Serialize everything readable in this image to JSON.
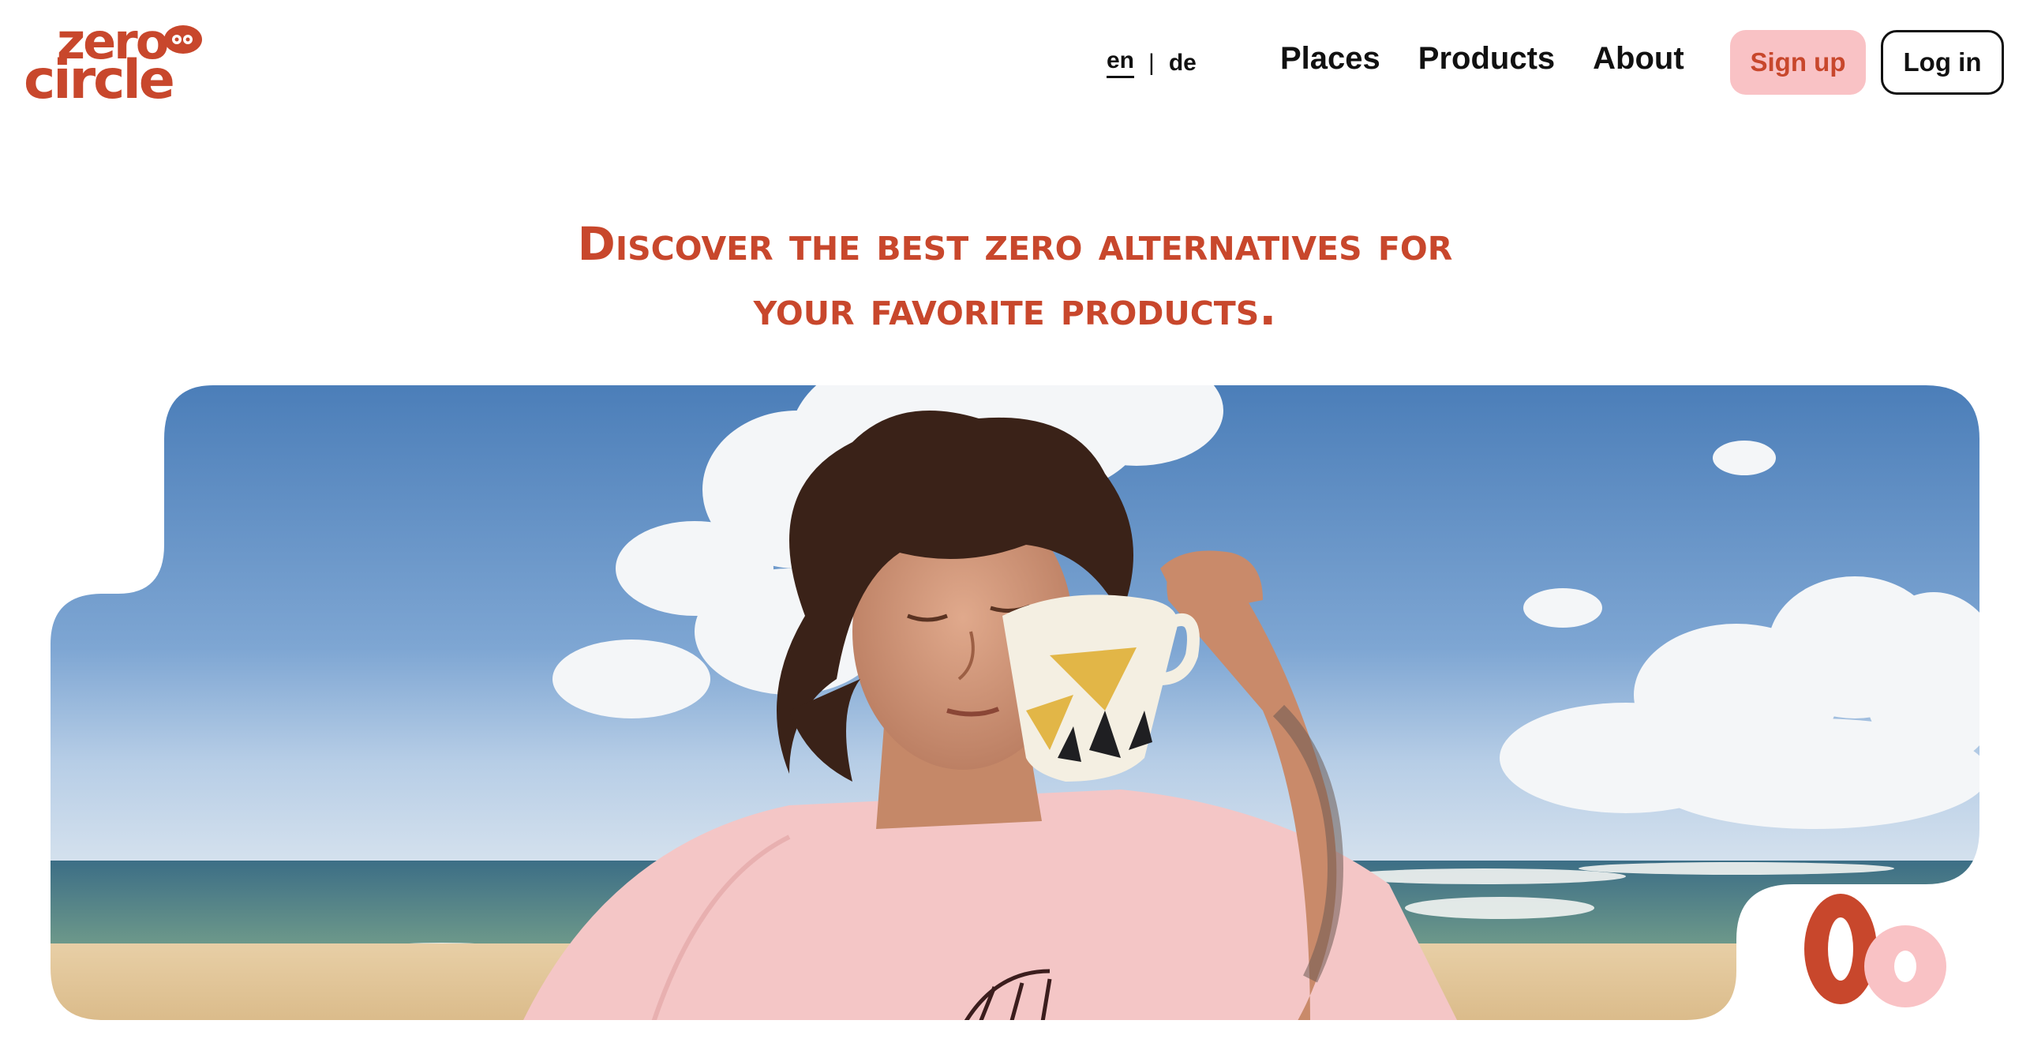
{
  "brand": {
    "logo_line1": "zero",
    "logo_line2": "circle",
    "accent_color": "#c8472c",
    "pink_color": "#f9c2c5"
  },
  "language": {
    "options": [
      "en",
      "de"
    ],
    "selected": "en",
    "separator": "|"
  },
  "nav": {
    "items": [
      {
        "label": "Places"
      },
      {
        "label": "Products"
      },
      {
        "label": "About"
      }
    ]
  },
  "auth": {
    "signup_label": "Sign up",
    "login_label": "Log in"
  },
  "hero": {
    "title_line1": "Discover the best zero alternatives for",
    "title_line2": "your favorite products.",
    "image_icon": "hero-photo",
    "badge_glyph": "0"
  }
}
